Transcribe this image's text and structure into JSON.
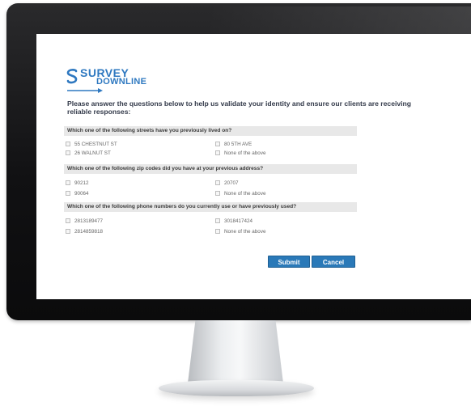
{
  "logo": {
    "line1": "SURVEY",
    "line2": "DOWNLINE"
  },
  "intro": "Please answer the questions below to help us validate your identity and ensure our clients are receiving reliable responses:",
  "questions": [
    {
      "text": "Which one of the following streets have you previously lived on?",
      "options": [
        "55 CHESTNUT ST",
        "80 5TH AVE",
        "26 WALNUT ST",
        "None of the above"
      ]
    },
    {
      "text": "Which one of the following zip codes did you have at your previous address?",
      "options": [
        "90212",
        "20707",
        "90064",
        "None of the above"
      ]
    },
    {
      "text": "Which one of the following phone numbers do you currently use or have previously used?",
      "options": [
        "2813189477",
        "3018417424",
        "2814859818",
        "None of the above"
      ]
    }
  ],
  "buttons": {
    "submit": "Submit",
    "cancel": "Cancel"
  },
  "colors": {
    "brand": "#2e78c0",
    "button": "#2a79b8",
    "header_bg": "#e8e8e8"
  }
}
